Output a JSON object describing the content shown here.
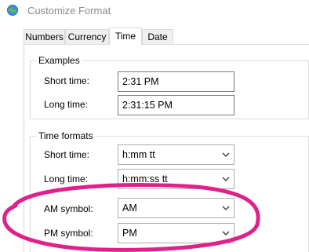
{
  "window": {
    "title": "Customize Format",
    "icon": "globe-settings-icon"
  },
  "tabs": [
    {
      "label": "Numbers"
    },
    {
      "label": "Currency"
    },
    {
      "label": "Time"
    },
    {
      "label": "Date"
    }
  ],
  "examples": {
    "title": "Examples",
    "short_time_label": "Short time:",
    "short_time_value": "2:31 PM",
    "long_time_label": "Long time:",
    "long_time_value": "2:31:15 PM"
  },
  "time_formats": {
    "title": "Time formats",
    "short_time_label": "Short time:",
    "short_time_value": "h:mm tt",
    "long_time_label": "Long time:",
    "long_time_value": "h:mm:ss tt",
    "am_symbol_label": "AM symbol:",
    "am_symbol_value": "AM",
    "pm_symbol_label": "PM symbol:",
    "pm_symbol_value": "PM"
  },
  "colors": {
    "highlight": "#e0218a",
    "tab_active": "#ffffff",
    "tab_inactive": "#f0f0f0"
  }
}
